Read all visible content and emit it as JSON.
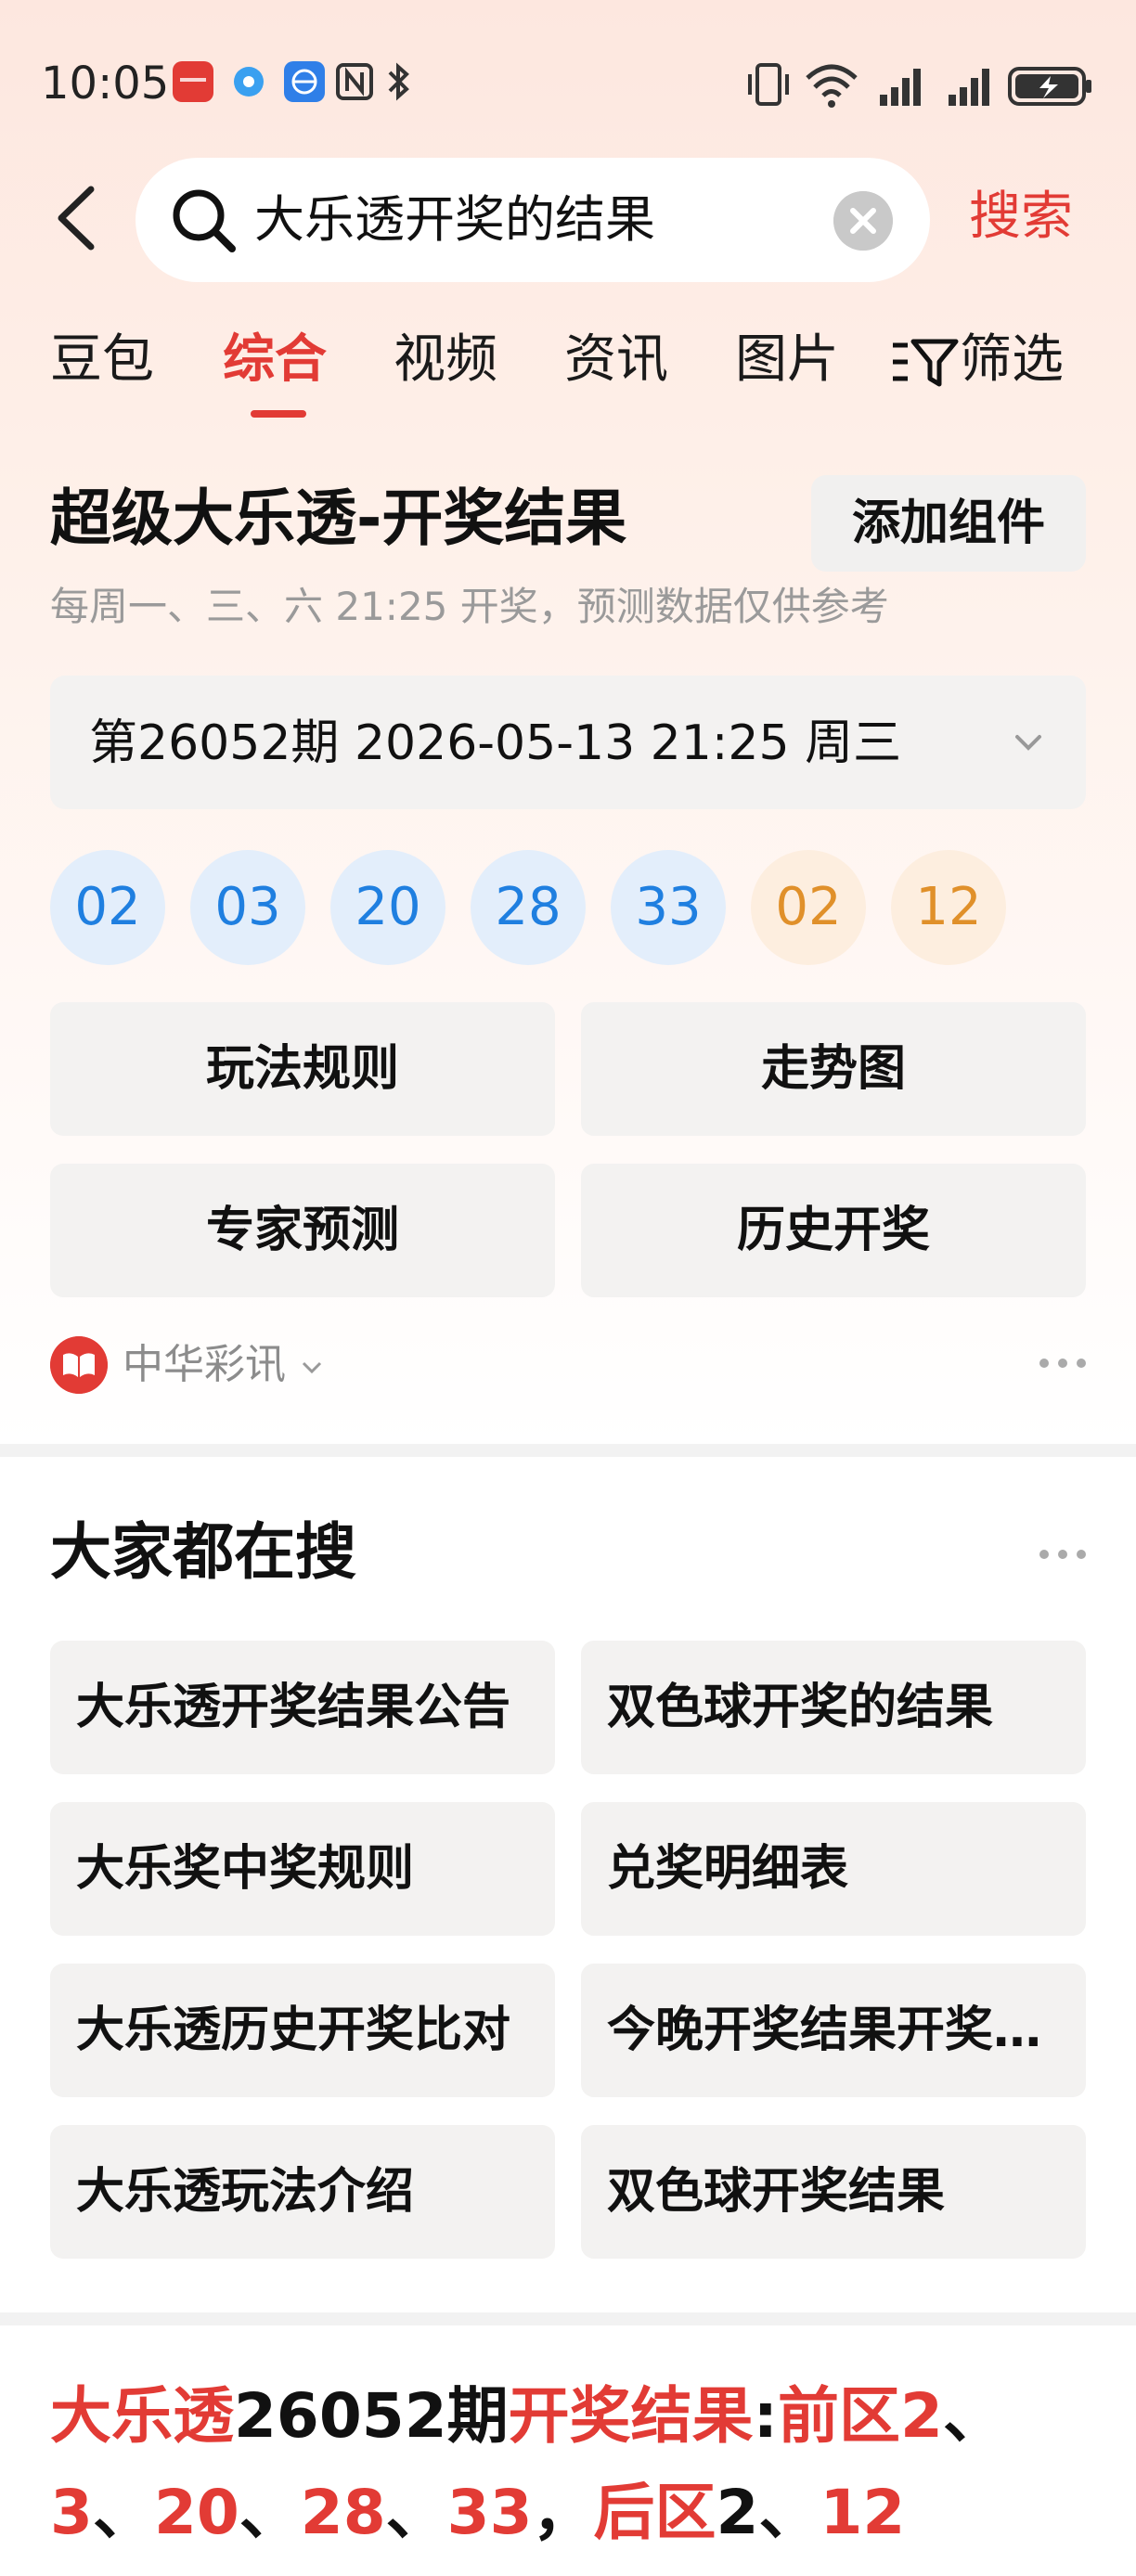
{
  "status_bar": {
    "time": "10:05"
  },
  "search": {
    "query": "大乐透开奖的结果",
    "submit_label": "搜索"
  },
  "tabs": [
    {
      "label": "豆包",
      "active": false
    },
    {
      "label": "综合",
      "active": true
    },
    {
      "label": "视频",
      "active": false
    },
    {
      "label": "资讯",
      "active": false
    },
    {
      "label": "图片",
      "active": false
    }
  ],
  "filter_label": "筛选",
  "lottery_card": {
    "title": "超级大乐透-开奖结果",
    "add_widget_label": "添加组件",
    "subtitle": "每周一、三、六 21:25 开奖，预测数据仅供参考",
    "period": "第26052期 2026-05-13 21:25 周三",
    "front_numbers": [
      "02",
      "03",
      "20",
      "28",
      "33"
    ],
    "back_numbers": [
      "02",
      "12"
    ],
    "actions": [
      "玩法规则",
      "走势图",
      "专家预测",
      "历史开奖"
    ],
    "source": "中华彩讯"
  },
  "hot_searches": {
    "title": "大家都在搜",
    "items": [
      "大乐透开奖结果公告",
      "双色球开奖的结果",
      "大乐奖中奖规则",
      "兑奖明细表",
      "大乐透历史开奖比对",
      "今晚开奖结果开奖号码",
      "大乐透玩法介绍",
      "双色球开奖结果"
    ]
  },
  "result_text": {
    "line1": [
      {
        "text": "大乐透",
        "red": true
      },
      {
        "text": "26052期",
        "red": false
      },
      {
        "text": "开奖结果",
        "red": true
      },
      {
        "text": ":",
        "red": false
      },
      {
        "text": "前区2",
        "red": true
      },
      {
        "text": "、",
        "red": false
      }
    ],
    "line2": [
      {
        "text": "3",
        "red": true
      },
      {
        "text": "、",
        "red": false
      },
      {
        "text": "20",
        "red": true
      },
      {
        "text": "、",
        "red": false
      },
      {
        "text": "28",
        "red": true
      },
      {
        "text": "、",
        "red": false
      },
      {
        "text": "33",
        "red": true
      },
      {
        "text": "，",
        "red": false
      },
      {
        "text": "后区",
        "red": true
      },
      {
        "text": "2",
        "red": false
      },
      {
        "text": "、",
        "red": false
      },
      {
        "text": "12",
        "red": true
      }
    ]
  },
  "colors": {
    "accent": "#e23b35",
    "front_ball": "#1f7fe0",
    "back_ball": "#e0902a"
  }
}
